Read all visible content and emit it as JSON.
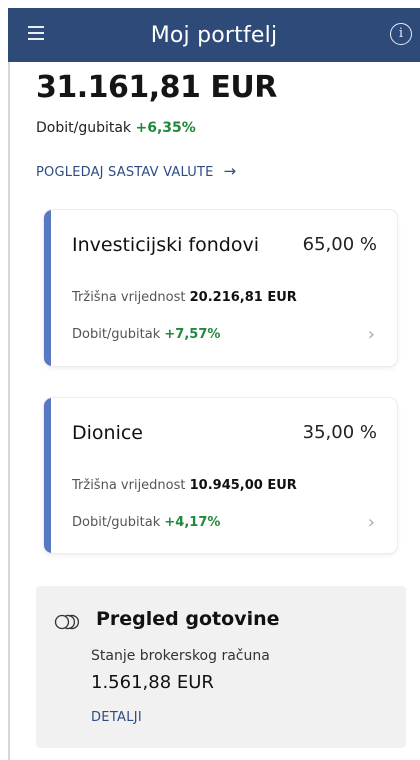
{
  "header": {
    "title": "Moj portfelj",
    "menu_icon": "hamburger-menu-icon",
    "info_icon": "info-icon",
    "info_glyph": "i"
  },
  "summary": {
    "total": "31.161,81 EUR",
    "profit_label": "Dobit/gubitak",
    "profit_value": "+6,35%",
    "currency_link": "POGLEDAJ SASTAV VALUTE",
    "currency_arrow": "→"
  },
  "cards": [
    {
      "title": "Investicijski fondovi",
      "percent": "65,00 %",
      "market_label": "Tržišna vrijednost",
      "market_value": "20.216,81 EUR",
      "profit_label": "Dobit/gubitak",
      "profit_value": "+7,57%",
      "chevron": "›"
    },
    {
      "title": "Dionice",
      "percent": "35,00 %",
      "market_label": "Tržišna vrijednost",
      "market_value": "10.945,00 EUR",
      "profit_label": "Dobit/gubitak",
      "profit_value": "+4,17%",
      "chevron": "›"
    }
  ],
  "cash": {
    "icon": "coins-icon",
    "title": "Pregled gotovine",
    "label": "Stanje brokerskog računa",
    "value": "1.561,88 EUR",
    "link": "DETALJI"
  },
  "colors": {
    "header_bg": "#2e4a78",
    "accent": "#5878c2",
    "positive": "#1f8a3b",
    "link": "#2f4c82"
  }
}
